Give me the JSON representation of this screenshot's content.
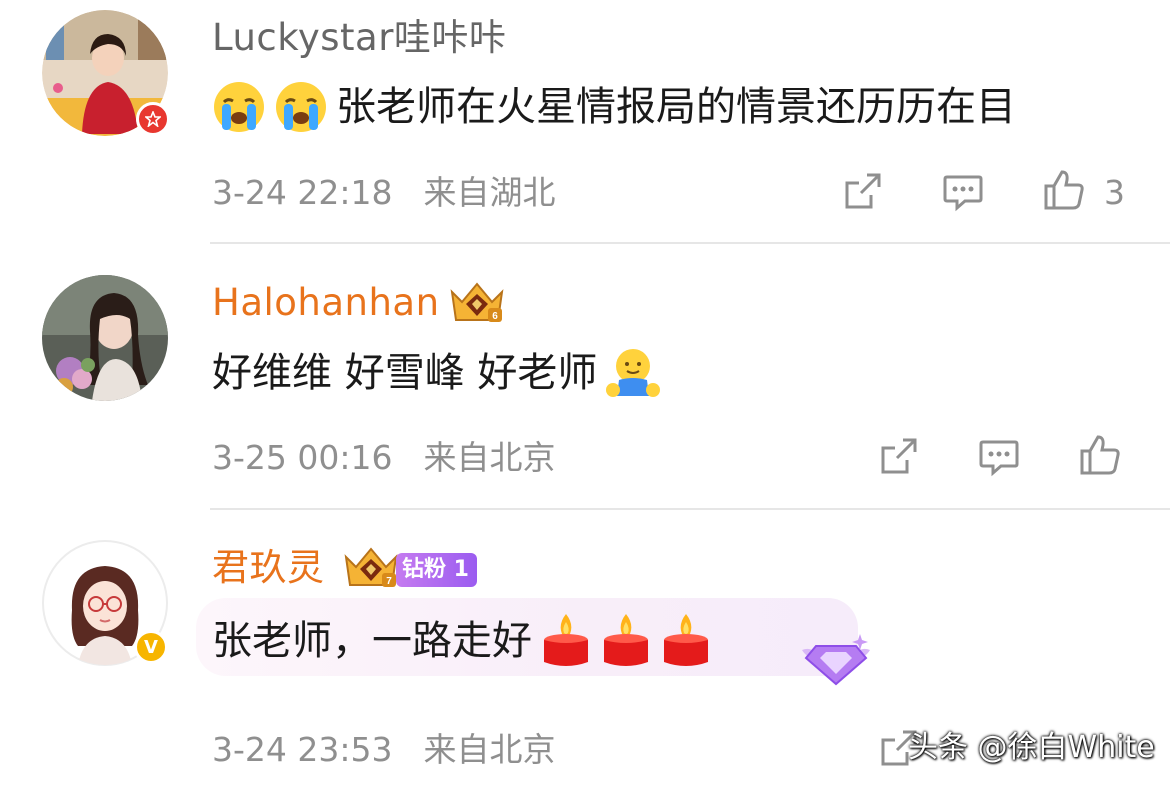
{
  "comments": [
    {
      "username": "Luckystar哇咔咔",
      "username_color": "#666666",
      "verified_badge": "red-star-badge",
      "emojis": [
        "crying-face-emoji",
        "crying-face-emoji"
      ],
      "text": "张老师在火星情报局的情景还历历在目",
      "time": "3-24 22:18",
      "location": "来自湖北",
      "like_count": "3"
    },
    {
      "username": "Halohanhan",
      "username_color": "#e8731c",
      "badge_icon": "gold-crown-level-6-badge",
      "text": "好维维 好雪峰 好老师",
      "trailing_emoji": "hug-emoji",
      "time": "3-25 00:16",
      "location": "来自北京",
      "like_count": ""
    },
    {
      "username": "君玖灵",
      "username_color": "#e8731c",
      "badge_icon": "gold-crown-level-7-badge",
      "fan_badge": "钻粉 1",
      "verified_badge": "yellow-v-badge",
      "text": "张老师，一路走好",
      "trailing_emojis": [
        "candle-emoji",
        "candle-emoji",
        "candle-emoji"
      ],
      "time": "3-24 23:53",
      "location": "来自北京"
    }
  ],
  "watermark": "头条 @徐白White",
  "colors": {
    "meta_gray": "#8f8f8f",
    "orange_name": "#e8731c",
    "divider": "#e6e6e6",
    "fan_badge_purple": "#a565f0"
  }
}
